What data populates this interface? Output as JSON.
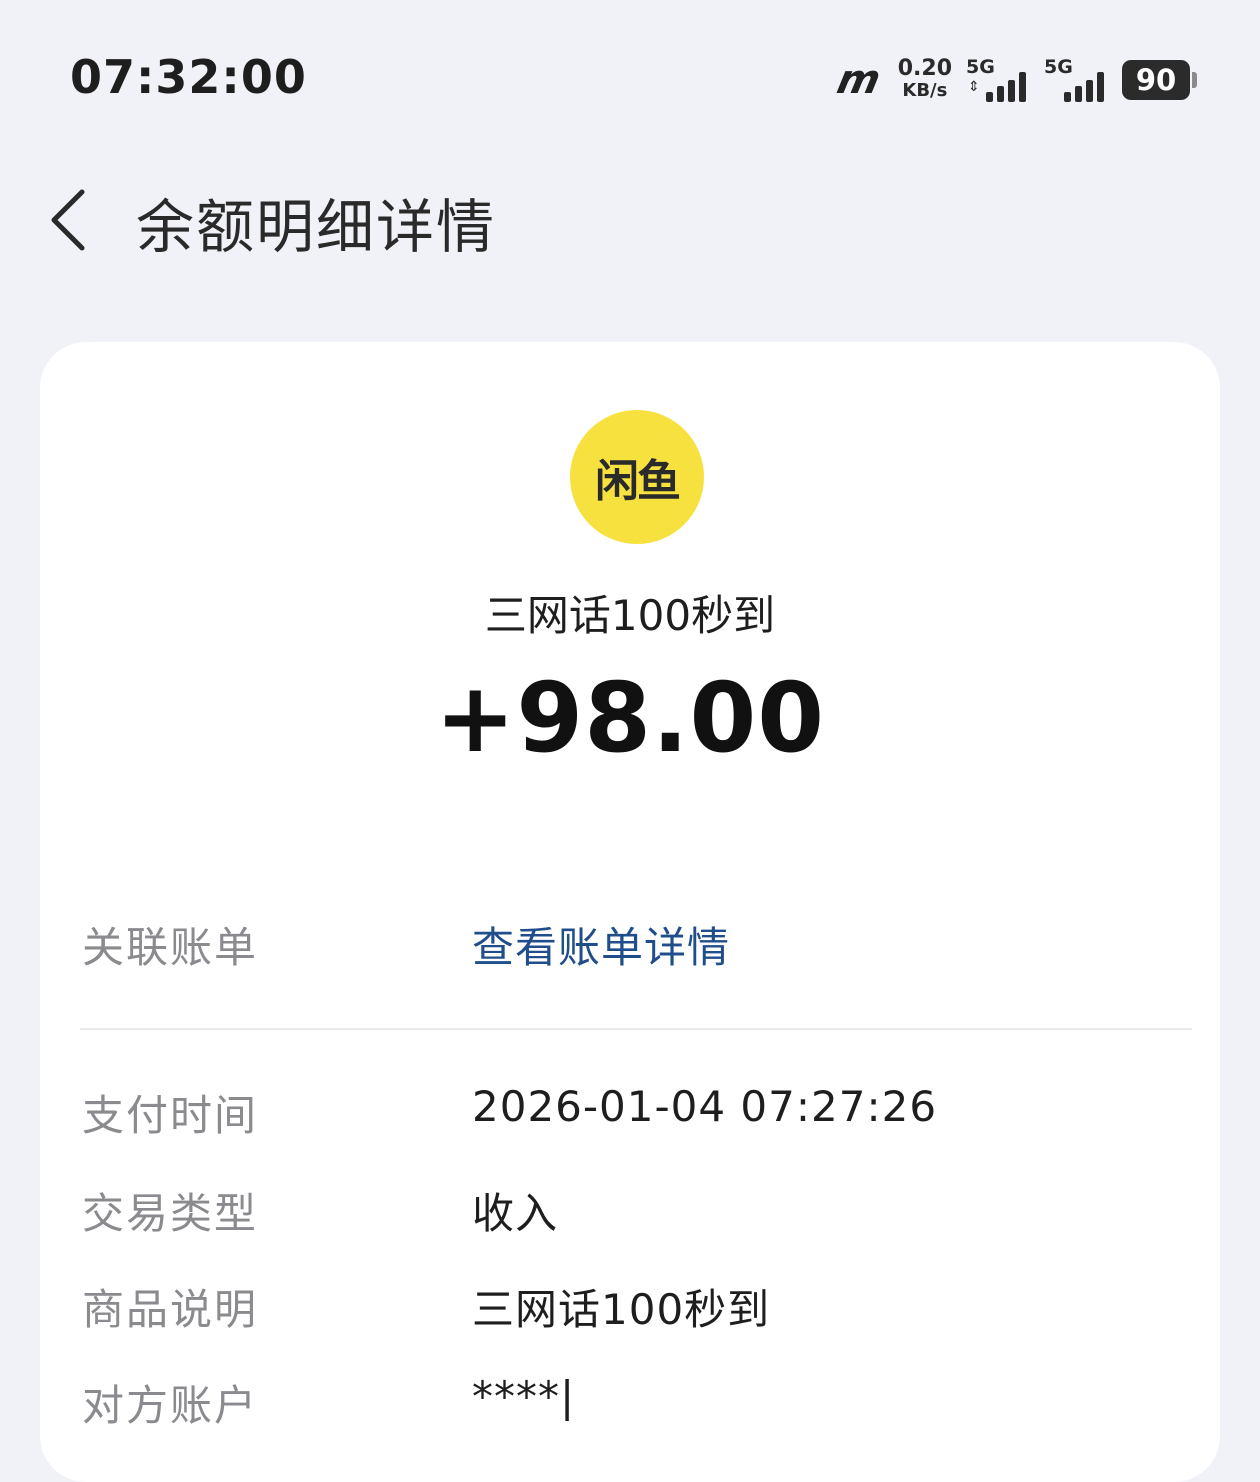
{
  "status_bar": {
    "time": "07:32:00",
    "carrier_icon": "mm-logo-icon",
    "net_speed_value": "0.20",
    "net_speed_unit": "KB/s",
    "sim1_label": "5G",
    "sim2_label": "5G",
    "battery_level": "90"
  },
  "header": {
    "title": "余额明细详情",
    "back_icon": "chevron-left-icon"
  },
  "transaction": {
    "logo_text": "闲鱼",
    "logo_color": "#f6e13f",
    "merchant_name": "三网话100秒到",
    "amount": "+98.00",
    "rows": {
      "related_bill_label": "关联账单",
      "related_bill_link": "查看账单详情",
      "pay_time_label": "支付时间",
      "pay_time_value": "2026-01-04 07:27:26",
      "type_label": "交易类型",
      "type_value": "收入",
      "desc_label": "商品说明",
      "desc_value": "三网话100秒到",
      "counterparty_label": "对方账户",
      "counterparty_value": "****|"
    }
  },
  "colors": {
    "background": "#f1f2f7",
    "card": "#ffffff",
    "link": "#1f4e8a",
    "label": "#8a8a8f"
  }
}
